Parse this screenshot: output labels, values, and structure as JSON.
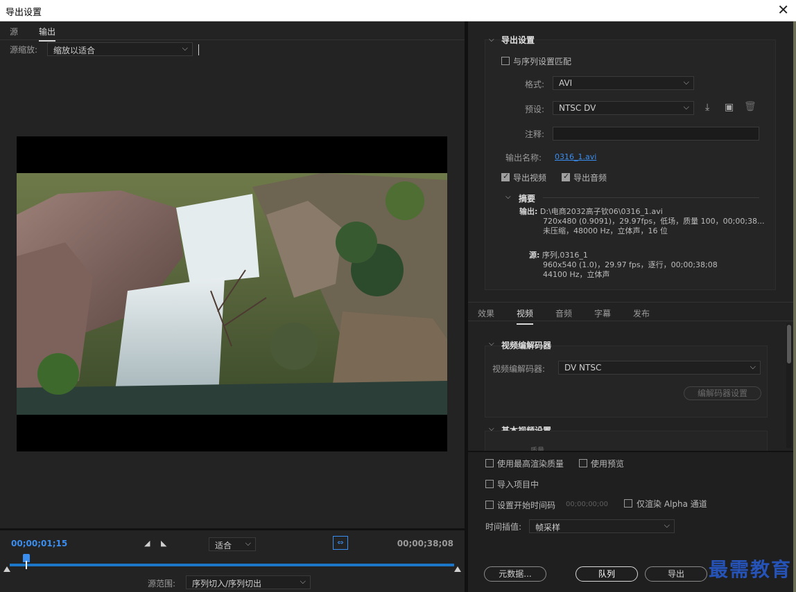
{
  "window": {
    "title": "导出设置",
    "close_glyph": "✕"
  },
  "left": {
    "tabs": [
      {
        "label": "源"
      },
      {
        "label": "输出"
      }
    ],
    "source_scale_label": "源缩放:",
    "source_scale_value": "缩放以适合",
    "timeline": {
      "current_tc": "00;00;01;15",
      "end_tc": "00;00;38;08",
      "mark_in_glyph": "◢",
      "mark_out_glyph": "◣",
      "fit_value": "适合",
      "fit_icon_glyph": "⇔",
      "playhead_fraction": 0.04,
      "range_label": "源范围:",
      "range_value": "序列切入/序列切出"
    }
  },
  "export_settings": {
    "title": "导出设置",
    "match_sequence_label": "与序列设置匹配",
    "match_sequence_checked": false,
    "format_label": "格式:",
    "format_value": "AVI",
    "preset_label": "预设:",
    "preset_value": "NTSC DV",
    "comments_label": "注释:",
    "output_name_label": "输出名称:",
    "output_name_value": "0316_1.avi",
    "export_video_label": "导出视频",
    "export_video_checked": true,
    "export_audio_label": "导出音频",
    "export_audio_checked": true,
    "summary": {
      "title": "摘要",
      "output_label": "输出:",
      "output_path": "D:\\电商2032高子钦06\\0316_1.avi",
      "output_line2": "720x480 (0.9091)，29.97fps，低场，质量 100，00;00;38...",
      "output_line3": "未压缩，48000 Hz，立体声，16 位",
      "source_label": "源:",
      "source_name": "序列,0316_1",
      "source_line2": "960x540 (1.0)，29.97 fps，逐行，00;00;38;08",
      "source_line3": "44100 Hz，立体声"
    }
  },
  "right_tabs": [
    {
      "label": "效果"
    },
    {
      "label": "视频"
    },
    {
      "label": "音频"
    },
    {
      "label": "字幕"
    },
    {
      "label": "发布"
    }
  ],
  "video_codec": {
    "title": "视频编解码器",
    "codec_label": "视频编解码器:",
    "codec_value": "DV NTSC",
    "codec_settings_button": "编解码器设置"
  },
  "basic_video": {
    "title": "基本视频设置",
    "partial_label": "质量"
  },
  "options": {
    "max_render_quality": "使用最高渲染质量",
    "use_previews": "使用预览",
    "import_into_project": "导入项目中",
    "set_start_tc": "设置开始时间码",
    "start_tc_value": "00;00;00;00",
    "render_alpha_only": "仅渲染 Alpha 通道",
    "time_interp_label": "时间插值:",
    "time_interp_value": "帧采样"
  },
  "buttons": {
    "metadata": "元数据...",
    "queue": "队列",
    "export": "导出"
  },
  "watermark": "最需教育"
}
